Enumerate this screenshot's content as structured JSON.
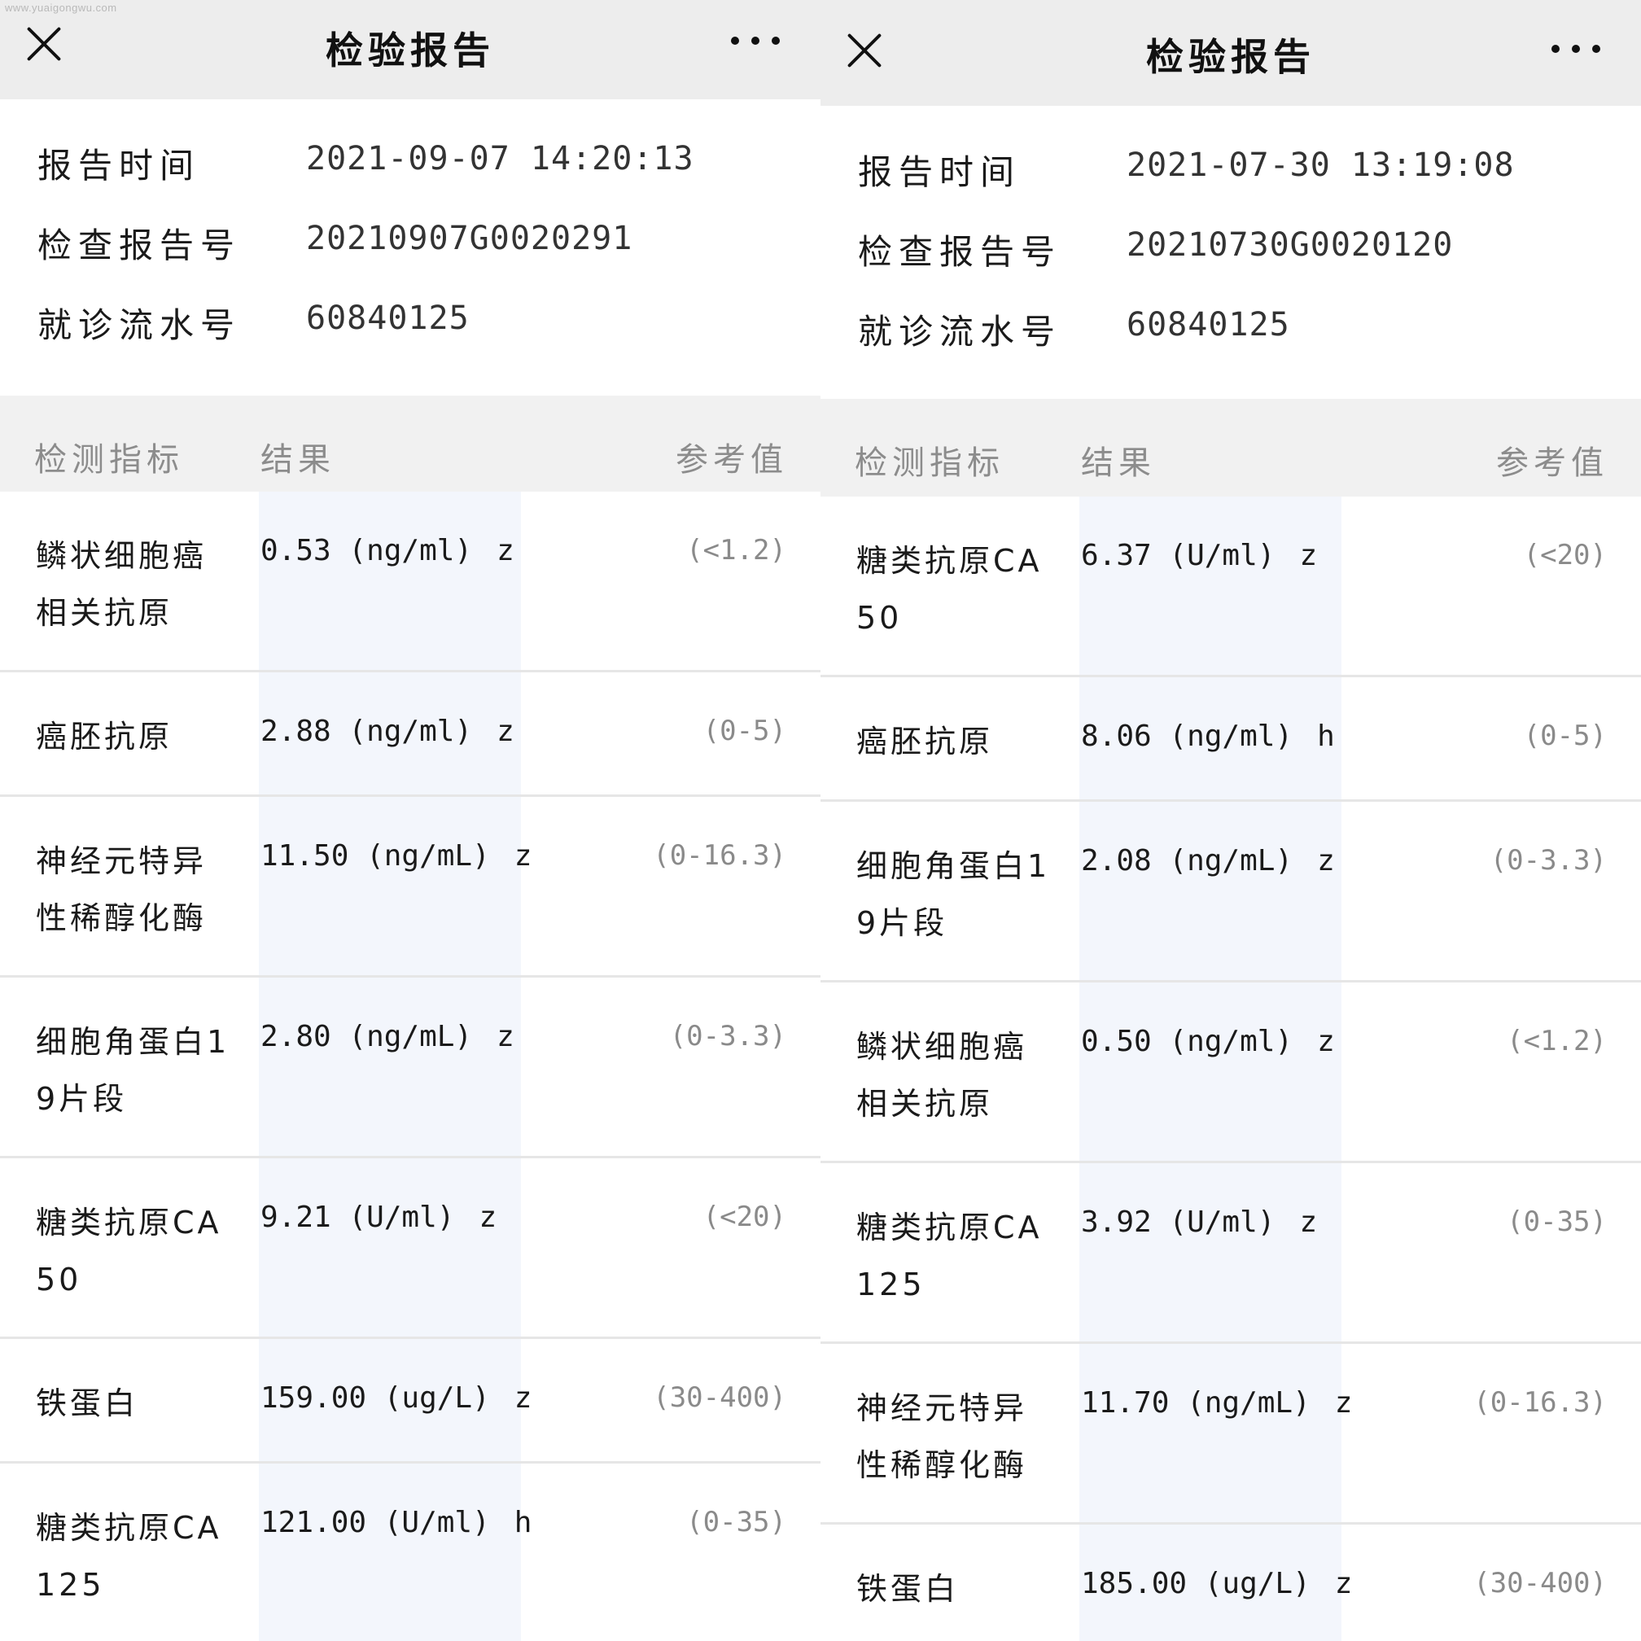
{
  "watermark": "www.yuaigongwu.com",
  "panels": [
    {
      "title": "检验报告",
      "info": [
        {
          "label": "报告时间",
          "value": "2021-09-07 14:20:13"
        },
        {
          "label": "检查报告号",
          "value": "20210907G0020291"
        },
        {
          "label": "就诊流水号",
          "value": "60840125"
        }
      ],
      "headers": {
        "name": "检测指标",
        "result": "结果",
        "ref": "参考值"
      },
      "rows": [
        {
          "name": "鳞状细胞癌相关抗原",
          "value": "0.53",
          "unit": "(ng/ml)",
          "flag": "z",
          "ref": "(<1.2)",
          "size": "tall"
        },
        {
          "name": "癌胚抗原",
          "value": "2.88",
          "unit": "(ng/ml)",
          "flag": "z",
          "ref": "(0-5)",
          "size": "short"
        },
        {
          "name": "神经元特异性稀醇化酶",
          "value": "11.50",
          "unit": "(ng/mL)",
          "flag": "z",
          "ref": "(0-16.3)",
          "size": "tall"
        },
        {
          "name": "细胞角蛋白19片段",
          "value": "2.80",
          "unit": "(ng/mL)",
          "flag": "z",
          "ref": "(0-3.3)",
          "size": "tall"
        },
        {
          "name": "糖类抗原CA50",
          "value": "9.21",
          "unit": "(U/ml)",
          "flag": "z",
          "ref": "(<20)",
          "size": "tall"
        },
        {
          "name": "铁蛋白",
          "value": "159.00",
          "unit": "(ug/L)",
          "flag": "z",
          "ref": "(30-400)",
          "size": "short"
        },
        {
          "name": "糖类抗原CA125",
          "value": "121.00",
          "unit": "(U/ml)",
          "flag": "h",
          "ref": "(0-35)",
          "size": "tall"
        }
      ]
    },
    {
      "title": "检验报告",
      "info": [
        {
          "label": "报告时间",
          "value": "2021-07-30 13:19:08"
        },
        {
          "label": "检查报告号",
          "value": "20210730G0020120"
        },
        {
          "label": "就诊流水号",
          "value": "60840125"
        }
      ],
      "headers": {
        "name": "检测指标",
        "result": "结果",
        "ref": "参考值"
      },
      "rows": [
        {
          "name": "糖类抗原CA50",
          "value": "6.37",
          "unit": "(U/ml)",
          "flag": "z",
          "ref": "(<20)",
          "size": "tall"
        },
        {
          "name": "癌胚抗原",
          "value": "8.06",
          "unit": "(ng/ml)",
          "flag": "h",
          "ref": "(0-5)",
          "size": "short"
        },
        {
          "name": "细胞角蛋白19片段",
          "value": "2.08",
          "unit": "(ng/mL)",
          "flag": "z",
          "ref": "(0-3.3)",
          "size": "tall"
        },
        {
          "name": "鳞状细胞癌相关抗原",
          "value": "0.50",
          "unit": "(ng/ml)",
          "flag": "z",
          "ref": "(<1.2)",
          "size": "tall"
        },
        {
          "name": "糖类抗原CA125",
          "value": "3.92",
          "unit": "(U/ml)",
          "flag": "z",
          "ref": "(0-35)",
          "size": "tall"
        },
        {
          "name": "神经元特异性稀醇化酶",
          "value": "11.70",
          "unit": "(ng/mL)",
          "flag": "z",
          "ref": "(0-16.3)",
          "size": "tall"
        },
        {
          "name": "铁蛋白",
          "value": "185.00",
          "unit": "(ug/L)",
          "flag": "z",
          "ref": "(30-400)",
          "size": "short"
        }
      ]
    }
  ]
}
